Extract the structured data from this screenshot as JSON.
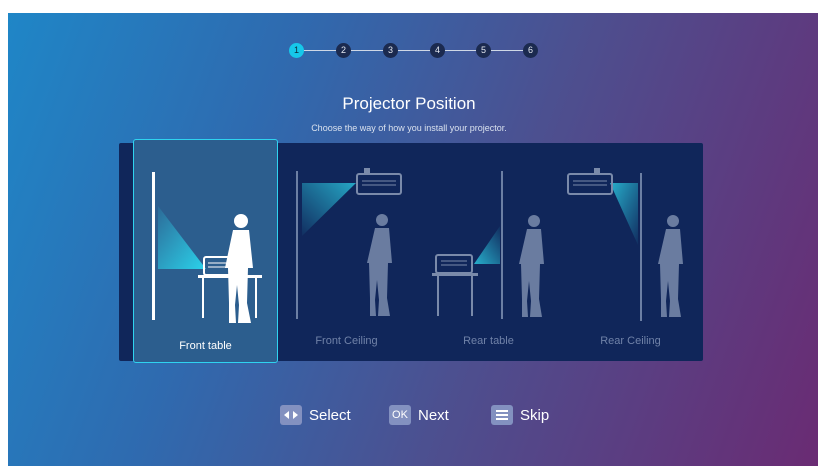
{
  "stepper": {
    "steps": [
      "1",
      "2",
      "3",
      "4",
      "5",
      "6"
    ],
    "active_index": 0
  },
  "header": {
    "title": "Projector Position",
    "subtitle": "Choose the way of how you install your projector."
  },
  "options": [
    {
      "label": "Front table",
      "selected": true
    },
    {
      "label": "Front Ceiling",
      "selected": false
    },
    {
      "label": "Rear table",
      "selected": false
    },
    {
      "label": "Rear Ceiling",
      "selected": false
    }
  ],
  "footer": {
    "select_label": "Select",
    "next_key": "OK",
    "next_label": "Next",
    "skip_label": "Skip"
  },
  "colors": {
    "accent": "#2fd3f0",
    "panel": "#10265a",
    "selected_card": "#2c5e8e"
  },
  "icons": [
    "left-right-arrows-icon",
    "ok-key-icon",
    "menu-icon"
  ]
}
